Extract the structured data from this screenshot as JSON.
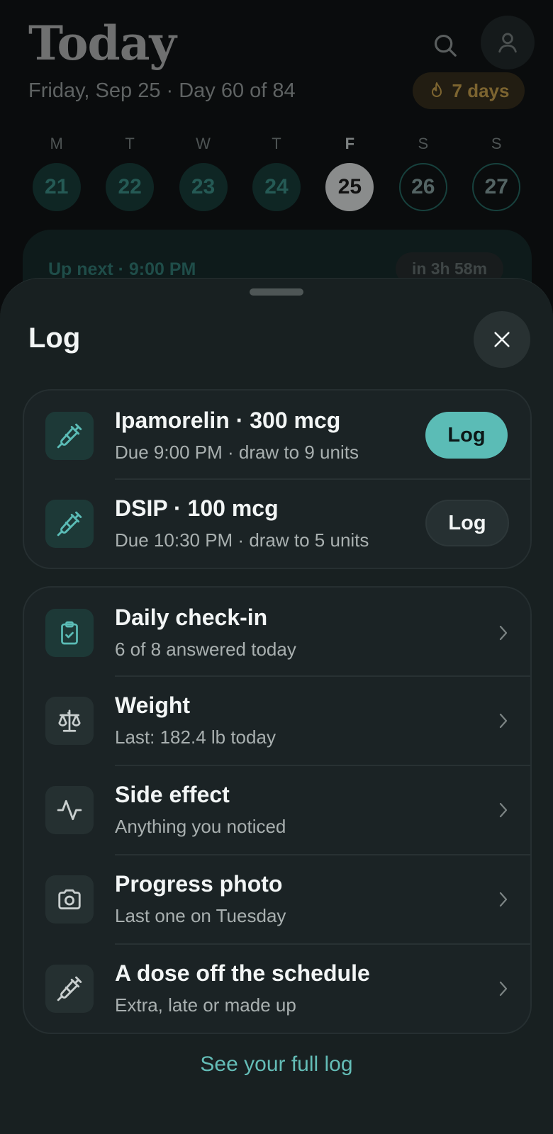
{
  "background": {
    "title": "Today",
    "subtitle": "Friday, Sep 25 · Day 60 of 84",
    "streak": "7 days",
    "week": [
      {
        "letter": "M",
        "date": "21",
        "state": "past"
      },
      {
        "letter": "T",
        "date": "22",
        "state": "past"
      },
      {
        "letter": "W",
        "date": "23",
        "state": "past"
      },
      {
        "letter": "T",
        "date": "24",
        "state": "past"
      },
      {
        "letter": "F",
        "date": "25",
        "state": "today"
      },
      {
        "letter": "S",
        "date": "26",
        "state": "future"
      },
      {
        "letter": "S",
        "date": "27",
        "state": "future"
      }
    ],
    "up_next": "Up next · 9:00 PM",
    "countdown": "in 3h 58m"
  },
  "sheet": {
    "title": "Log",
    "doses": [
      {
        "title": "Ipamorelin · 300 mcg",
        "subtitle": "Due 9:00 PM · draw to 9 units",
        "button": "Log",
        "icon": "syringe-icon"
      },
      {
        "title": "DSIP · 100 mcg",
        "subtitle": "Due 10:30 PM · draw to 5 units",
        "button": "Log",
        "icon": "syringe-icon"
      }
    ],
    "items": [
      {
        "title": "Daily check-in",
        "subtitle": "6 of 8 answered today",
        "icon": "clipboard-check-icon"
      },
      {
        "title": "Weight",
        "subtitle": "Last: 182.4 lb today",
        "icon": "scale-icon"
      },
      {
        "title": "Side effect",
        "subtitle": "Anything you noticed",
        "icon": "activity-icon"
      },
      {
        "title": "Progress photo",
        "subtitle": "Last one on Tuesday",
        "icon": "camera-icon"
      },
      {
        "title": "A dose off the schedule",
        "subtitle": "Extra, late or made up",
        "icon": "syringe-icon"
      }
    ],
    "footer_link": "See your full log"
  },
  "colors": {
    "accent": "#5bbcb6",
    "sheet_bg": "#182021",
    "card_bg": "#1b2325"
  }
}
